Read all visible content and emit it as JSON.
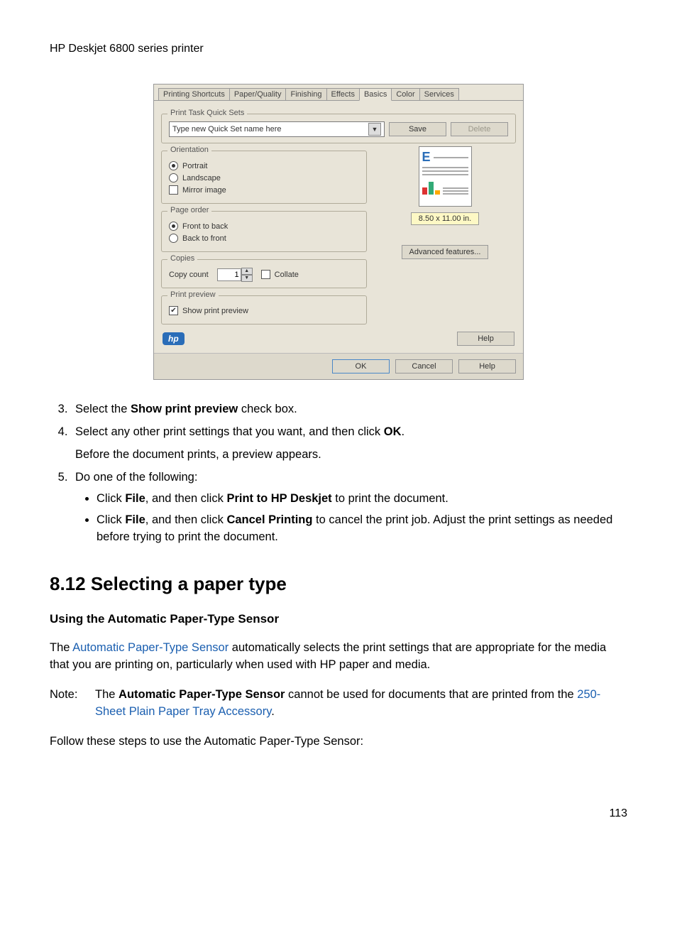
{
  "header": {
    "title": "HP Deskjet 6800 series printer"
  },
  "dialog": {
    "tabs": [
      "Printing Shortcuts",
      "Paper/Quality",
      "Finishing",
      "Effects",
      "Basics",
      "Color",
      "Services"
    ],
    "active_tab": "Basics",
    "quicksets": {
      "legend": "Print Task Quick Sets",
      "combo_text": "Type new Quick Set name here",
      "save": "Save",
      "delete": "Delete"
    },
    "orientation": {
      "legend": "Orientation",
      "portrait": "Portrait",
      "landscape": "Landscape",
      "mirror": "Mirror image"
    },
    "pageorder": {
      "legend": "Page order",
      "front": "Front to back",
      "back": "Back to front"
    },
    "copies": {
      "legend": "Copies",
      "label": "Copy count",
      "value": "1",
      "collate": "Collate"
    },
    "printpreview": {
      "legend": "Print preview",
      "show": "Show print preview"
    },
    "papersize": "8.50 x 11.00 in.",
    "advanced": "Advanced features...",
    "hp_logo": "hp",
    "help_inner": "Help",
    "footer": {
      "ok": "OK",
      "cancel": "Cancel",
      "help": "Help"
    }
  },
  "doc": {
    "step3_pre": "Select the ",
    "step3_b": "Show print preview",
    "step3_post": " check box.",
    "step4_pre": "Select any other print settings that you want, and then click ",
    "step4_b": "OK",
    "step4_post": ".",
    "step4_sub": "Before the document prints, a preview appears.",
    "step5": "Do one of the following:",
    "step5a_pre": "Click ",
    "step5a_b1": "File",
    "step5a_mid": ", and then click ",
    "step5a_b2": "Print to HP Deskjet",
    "step5a_post": " to print the document.",
    "step5b_pre": "Click ",
    "step5b_b1": "File",
    "step5b_mid": ", and then click ",
    "step5b_b2": "Cancel Printing",
    "step5b_post": " to cancel the print job. Adjust the print settings as needed before trying to print the document.",
    "section": "8.12  Selecting a paper type",
    "subheading": "Using the Automatic Paper-Type Sensor",
    "para1_pre": "The ",
    "para1_link": "Automatic Paper-Type Sensor",
    "para1_post": " automatically selects the print settings that are appropriate for the media that you are printing on, particularly when used with HP paper and media.",
    "note_label": "Note:",
    "note_pre": "The ",
    "note_b": "Automatic Paper-Type Sensor",
    "note_mid": " cannot be used for documents that are printed from the ",
    "note_link": "250-Sheet Plain Paper Tray Accessory",
    "note_post": ".",
    "para2": "Follow these steps to use the Automatic Paper-Type Sensor:",
    "page_num": "113"
  }
}
